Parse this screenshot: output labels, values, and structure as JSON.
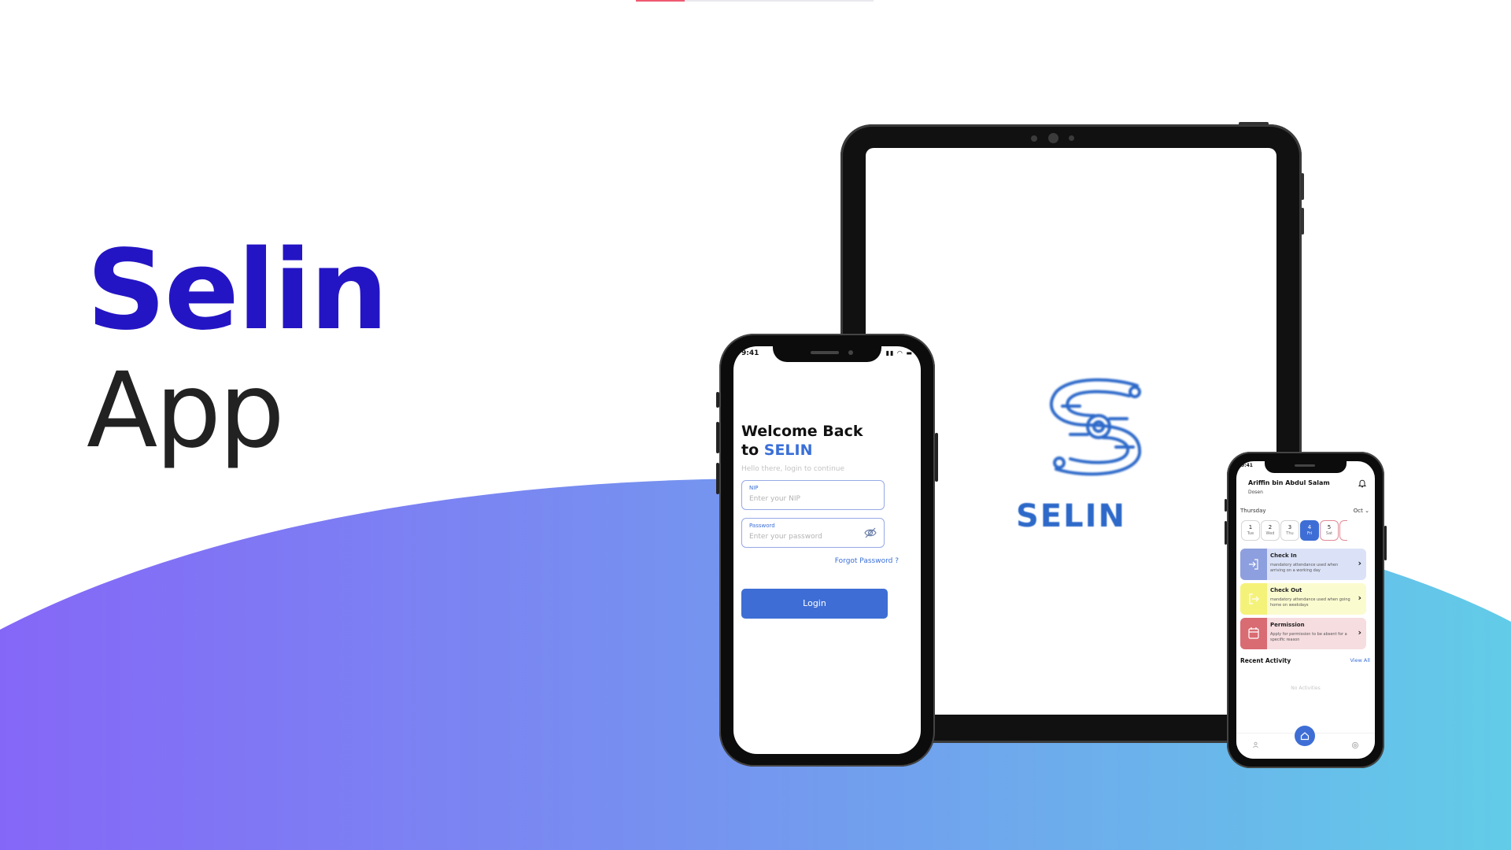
{
  "hero": {
    "title": "Selin",
    "subtitle": "App"
  },
  "colors": {
    "brand": "#2415c4",
    "primary": "#3e6ed5",
    "gradient_start": "#8567f7",
    "gradient_end": "#62cce8"
  },
  "tablet": {
    "logo_icon": "selin-s-logo",
    "logo_text": "SELIN"
  },
  "login_phone": {
    "status_time": "9:41",
    "status_icons": "▮▮ ◠ ▬",
    "title_line1": "Welcome Back",
    "title_line2_prefix": "to ",
    "brand": "SELIN",
    "subtitle": "Hello there, login to continue",
    "nip": {
      "label": "NIP",
      "placeholder": "Enter your NIP"
    },
    "password": {
      "label": "Password",
      "placeholder": "Enter your password",
      "icon": "eye-off-icon"
    },
    "forgot": "Forgot Password ?",
    "login_button": "Login"
  },
  "dashboard_phone": {
    "status_time": "9:41",
    "user_name": "Ariffin bin Abdul Salam",
    "user_role": "Dosen",
    "weekday": "Thursday",
    "month": "Oct ⌄",
    "days": [
      {
        "num": "1",
        "label": "Tue"
      },
      {
        "num": "2",
        "label": "Wed"
      },
      {
        "num": "3",
        "label": "Thu"
      },
      {
        "num": "4",
        "label": "Fri"
      },
      {
        "num": "5",
        "label": "Sat"
      }
    ],
    "cards": [
      {
        "title": "Check In",
        "desc": "mandatory attendance used when arriving on a working day",
        "bg": "#dbe2f7",
        "icon_bg": "#8e9fdf",
        "icon": "check-in-icon"
      },
      {
        "title": "Check Out",
        "desc": "mandatory attendance used when going home on weekdays",
        "bg": "#fbfbd0",
        "icon_bg": "#f5f27a",
        "icon": "check-out-icon"
      },
      {
        "title": "Permission",
        "desc": "Apply for permission to be absent for a specific reason",
        "bg": "#f6dde0",
        "icon_bg": "#d96b73",
        "icon": "calendar-icon"
      }
    ],
    "recent_activity": "Recent Activity",
    "view_all": "View All",
    "no_activities": "No Activities",
    "nav": {
      "left_icon": "user-icon",
      "center_icon": "home-icon",
      "right_icon": "settings-icon"
    }
  }
}
